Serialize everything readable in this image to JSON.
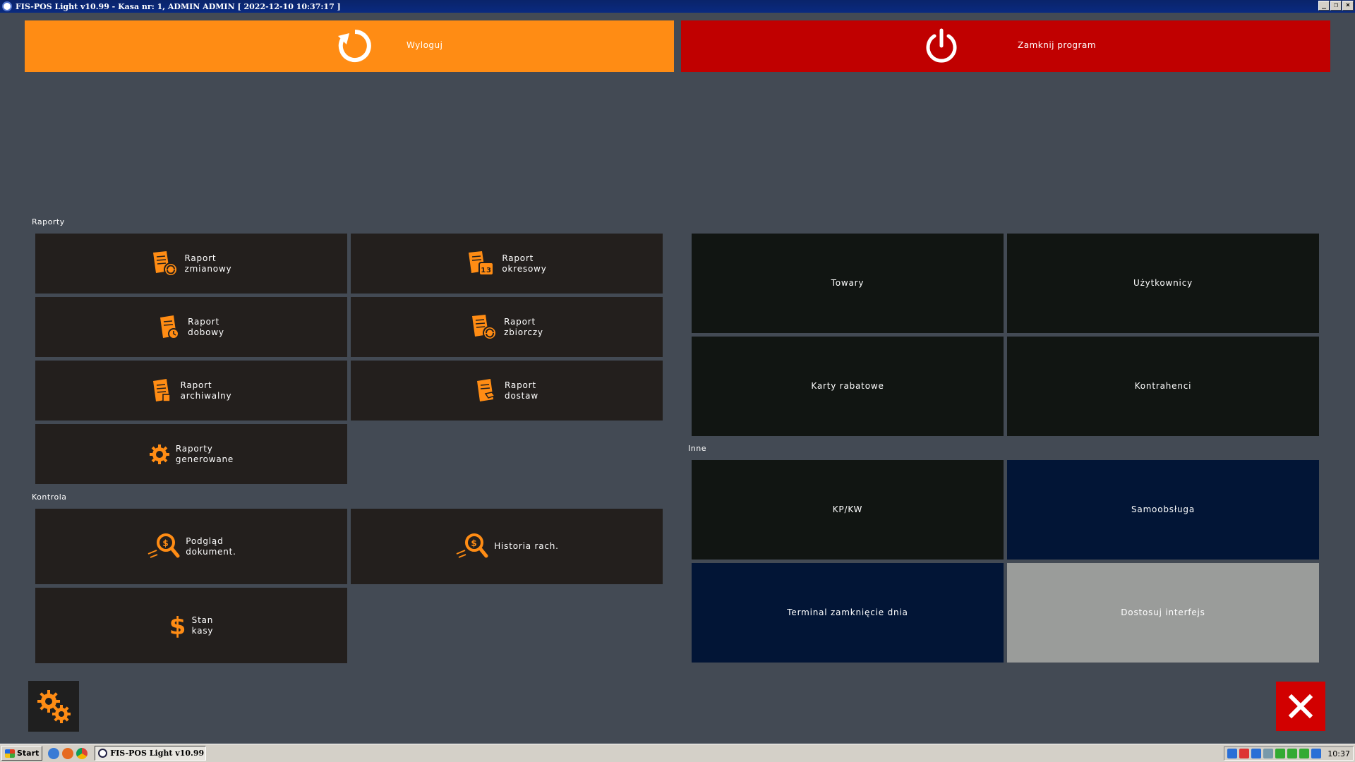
{
  "window": {
    "title": "FIS-POS Light v10.99 - Kasa nr: 1, ADMIN ADMIN [ 2022-12-10 10:37:17 ]",
    "controls": [
      "_",
      "❐",
      "×"
    ]
  },
  "top": {
    "logout_label": "Wyloguj",
    "close_label": "Zamknij program"
  },
  "sections": {
    "reports": "Raporty",
    "control": "Kontrola",
    "other": "Inne"
  },
  "reports": {
    "shift": [
      "Raport",
      "zmianowy"
    ],
    "period": [
      "Raport",
      "okresowy"
    ],
    "daily": [
      "Raport",
      "dobowy"
    ],
    "summary": [
      "Raport",
      "zbiorczy"
    ],
    "archive": [
      "Raport",
      "archiwalny"
    ],
    "delivery": [
      "Raport",
      "dostaw"
    ],
    "generated": [
      "Raporty",
      "generowane"
    ]
  },
  "control": {
    "preview": [
      "Podgląd",
      "dokument."
    ],
    "history": "Historia rach.",
    "cash": [
      "Stan",
      "kasy"
    ]
  },
  "manage": {
    "products": "Towary",
    "users": "Użytkownicy",
    "cards": "Karty rabatowe",
    "contractors": "Kontrahenci"
  },
  "other": {
    "kpkw": "KP/KW",
    "selfservice": "Samoobsługa",
    "terminal": "Terminal zamknięcie dnia",
    "customize": "Dostosuj interfejs"
  },
  "calendar_day": "13",
  "colors": {
    "accent_orange": "#ff8c14",
    "danger_red": "#c00000",
    "background": "#434a54",
    "tile_brown": "#231f1d",
    "tile_dark": "#111512",
    "tile_navy": "#021536",
    "tile_gray": "#9a9c9a"
  },
  "taskbar": {
    "start": "Start",
    "task": "FIS-POS Light v10.99 ...",
    "clock": "10:37"
  }
}
